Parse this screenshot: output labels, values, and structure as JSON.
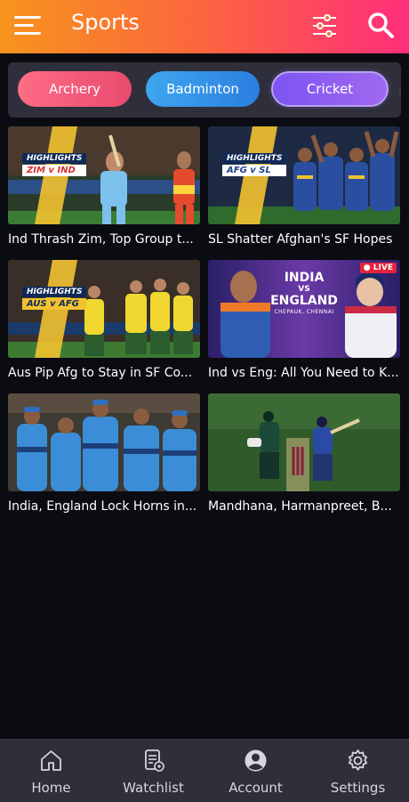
{
  "header": {
    "title": "Sports"
  },
  "chips": [
    {
      "label": "Archery"
    },
    {
      "label": "Badminton"
    },
    {
      "label": "Cricket"
    }
  ],
  "videos": [
    {
      "title": "Ind Thrash Zim, Top Group t...",
      "badge_highlight": "HIGHLIGHTS",
      "badge_match": "ZIM v IND"
    },
    {
      "title": "SL Shatter Afghan's SF Hopes",
      "badge_highlight": "HIGHLIGHTS",
      "badge_match": "AFG v SL"
    },
    {
      "title": "Aus Pip Afg to Stay in SF Co...",
      "badge_highlight": "HIGHLIGHTS",
      "badge_match": "AUS v AFG"
    },
    {
      "title": "Ind vs Eng: All You Need to K...",
      "live": "LIVE",
      "poster_line1": "INDIA",
      "poster_line2": "VS",
      "poster_line3": "ENGLAND",
      "poster_line4": "CHEPAUK, CHENNAI"
    },
    {
      "title": "India, England Lock Horns in..."
    },
    {
      "title": "Mandhana, Harmanpreet, B..."
    }
  ],
  "nav": [
    {
      "label": "Home",
      "icon": "home-icon"
    },
    {
      "label": "Watchlist",
      "icon": "watchlist-icon"
    },
    {
      "label": "Account",
      "icon": "account-icon"
    },
    {
      "label": "Settings",
      "icon": "gear-icon"
    }
  ]
}
